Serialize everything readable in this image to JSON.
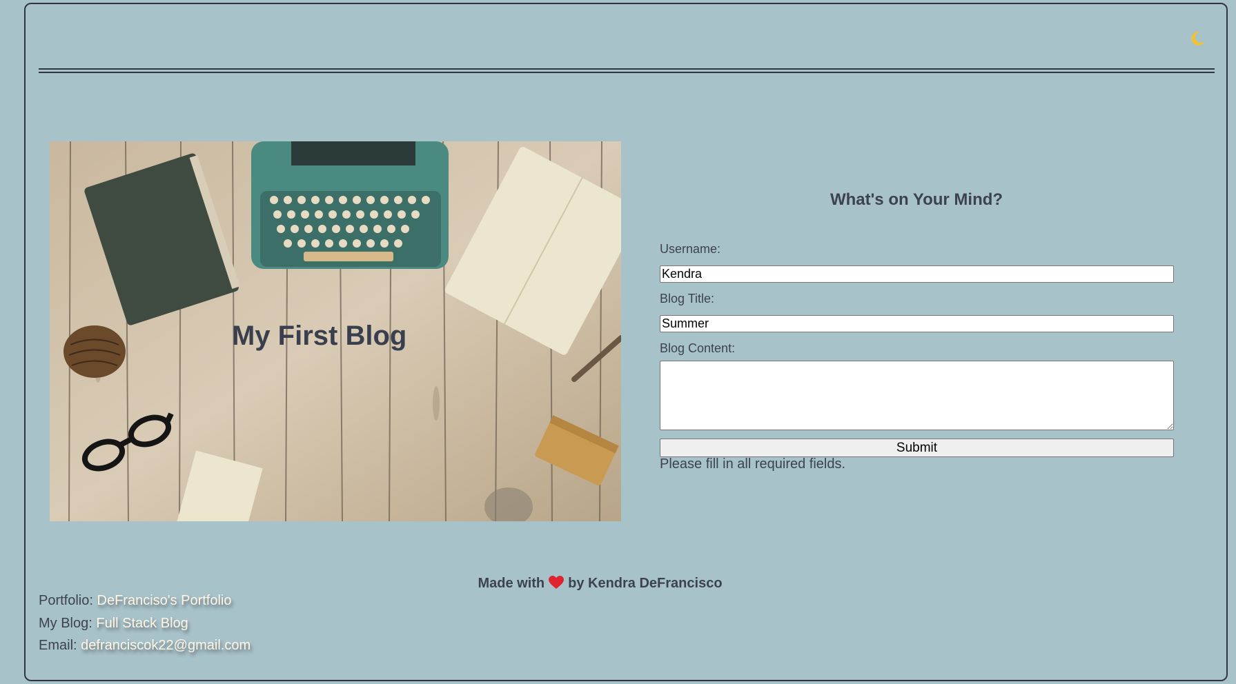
{
  "colors": {
    "background": "#a8c2ca",
    "text": "#3d4250",
    "link": "#fff6e6",
    "heart": "#e0242f",
    "moon": "#f2c230"
  },
  "header": {
    "theme_toggle_icon": "moon-icon"
  },
  "hero": {
    "title": "My First Blog",
    "image_icon": "typewriter-desk-image"
  },
  "form": {
    "heading": "What's on Your Mind?",
    "username_label": "Username:",
    "username_value": "Kendra",
    "title_label": "Blog Title:",
    "title_value": "Summer",
    "content_label": "Blog Content:",
    "content_value": "",
    "submit_label": "Submit",
    "message": "Please fill in all required fields."
  },
  "footer": {
    "made_with_prefix": "Made with",
    "made_with_suffix": "by Kendra DeFrancisco",
    "heart_icon": "heart-icon",
    "portfolio_label": "Portfolio:",
    "portfolio_link": "DeFranciso's Portfolio",
    "blog_label": "My Blog:",
    "blog_link": "Full Stack Blog",
    "email_label": "Email:",
    "email_link": "defranciscok22@gmail.com"
  }
}
